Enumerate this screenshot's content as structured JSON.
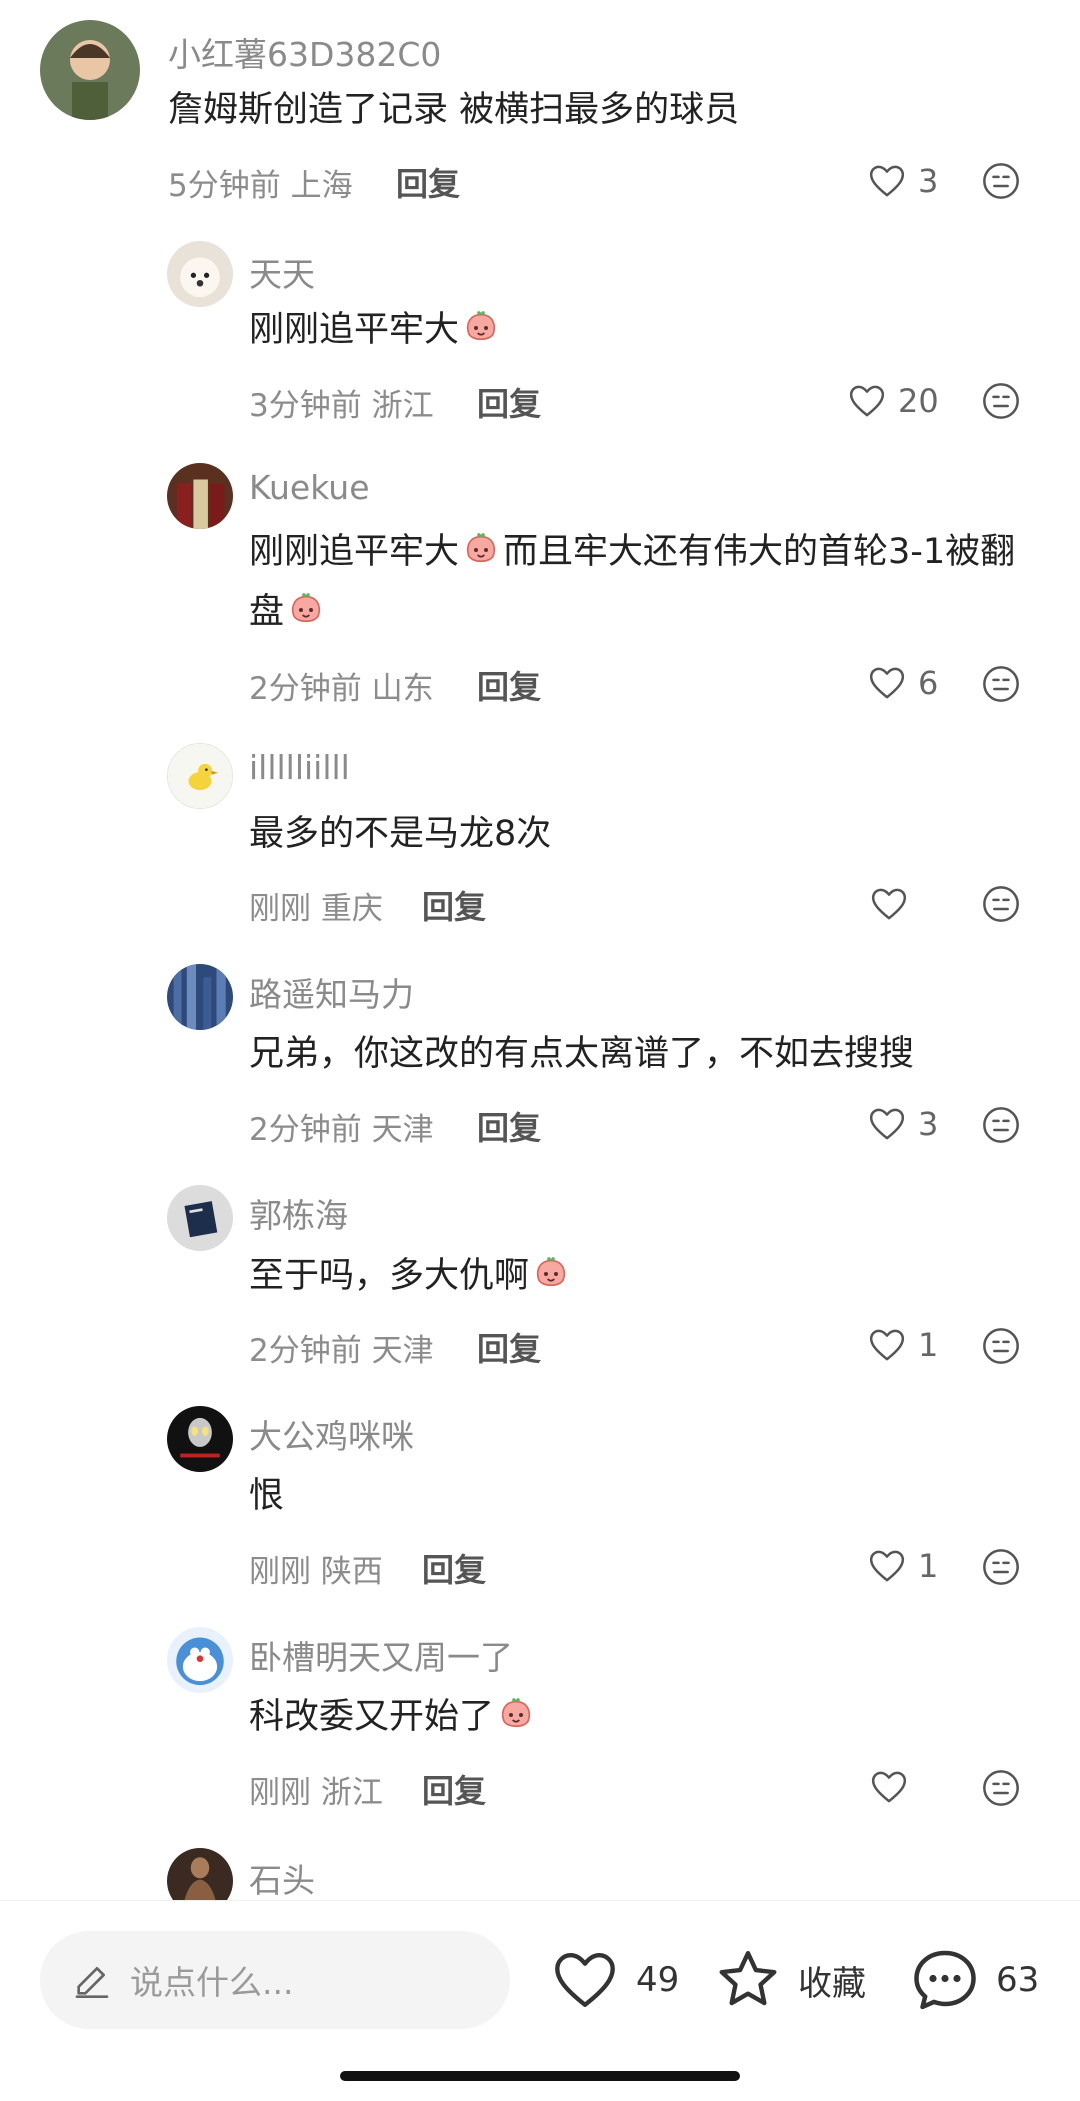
{
  "comments": [
    {
      "user": "小红薯63D382C0",
      "text": "詹姆斯创造了记录 被横扫最多的球员",
      "time": "5分钟前",
      "location": "上海",
      "reply": "回复",
      "likes": "3",
      "avatar_color": "#6b7a5a"
    },
    {
      "user": "天天",
      "text": "刚刚追平牢大",
      "time": "3分钟前",
      "location": "浙江",
      "reply": "回复",
      "likes": "20",
      "avatar_color": "#e8e2d8"
    },
    {
      "user": "Kuekue",
      "text_a": "刚刚追平牢大",
      "text_b": "而且牢大还有伟大的首轮3-1被翻盘",
      "time": "2分钟前",
      "location": "山东",
      "reply": "回复",
      "likes": "6",
      "avatar_color": "#5a3020"
    },
    {
      "user": "illllliilll",
      "text": "最多的不是马龙8次",
      "time": "刚刚",
      "location": "重庆",
      "reply": "回复",
      "likes": "",
      "avatar_color": "#f7f7f2"
    },
    {
      "user": "路遥知马力",
      "text": "兄弟，你这改的有点太离谱了，不如去搜搜",
      "time": "2分钟前",
      "location": "天津",
      "reply": "回复",
      "likes": "3",
      "avatar_color": "#2e4a7a"
    },
    {
      "user": "郭栋海",
      "text": "至于吗，多大仇啊",
      "time": "2分钟前",
      "location": "天津",
      "reply": "回复",
      "likes": "1",
      "avatar_color": "#cfcfcf"
    },
    {
      "user": "大公鸡咪咪",
      "text": "恨",
      "time": "刚刚",
      "location": "陕西",
      "reply": "回复",
      "likes": "1",
      "avatar_color": "#111111"
    },
    {
      "user": "卧槽明天又周一了",
      "text": "科改委又开始了",
      "time": "刚刚",
      "location": "浙江",
      "reply": "回复",
      "likes": "",
      "avatar_color": "#4a90d9"
    },
    {
      "user": "石头",
      "avatar_color": "#3a2a22"
    }
  ],
  "bottom_bar": {
    "input_placeholder": "说点什么...",
    "like_count": "49",
    "collect_label": "收藏",
    "comment_count": "63"
  },
  "icons": {
    "like": "heart-outline-icon",
    "emoji": "emoji-face-icon",
    "pen": "pen-icon",
    "star": "star-icon",
    "chat": "chat-bubble-icon"
  }
}
